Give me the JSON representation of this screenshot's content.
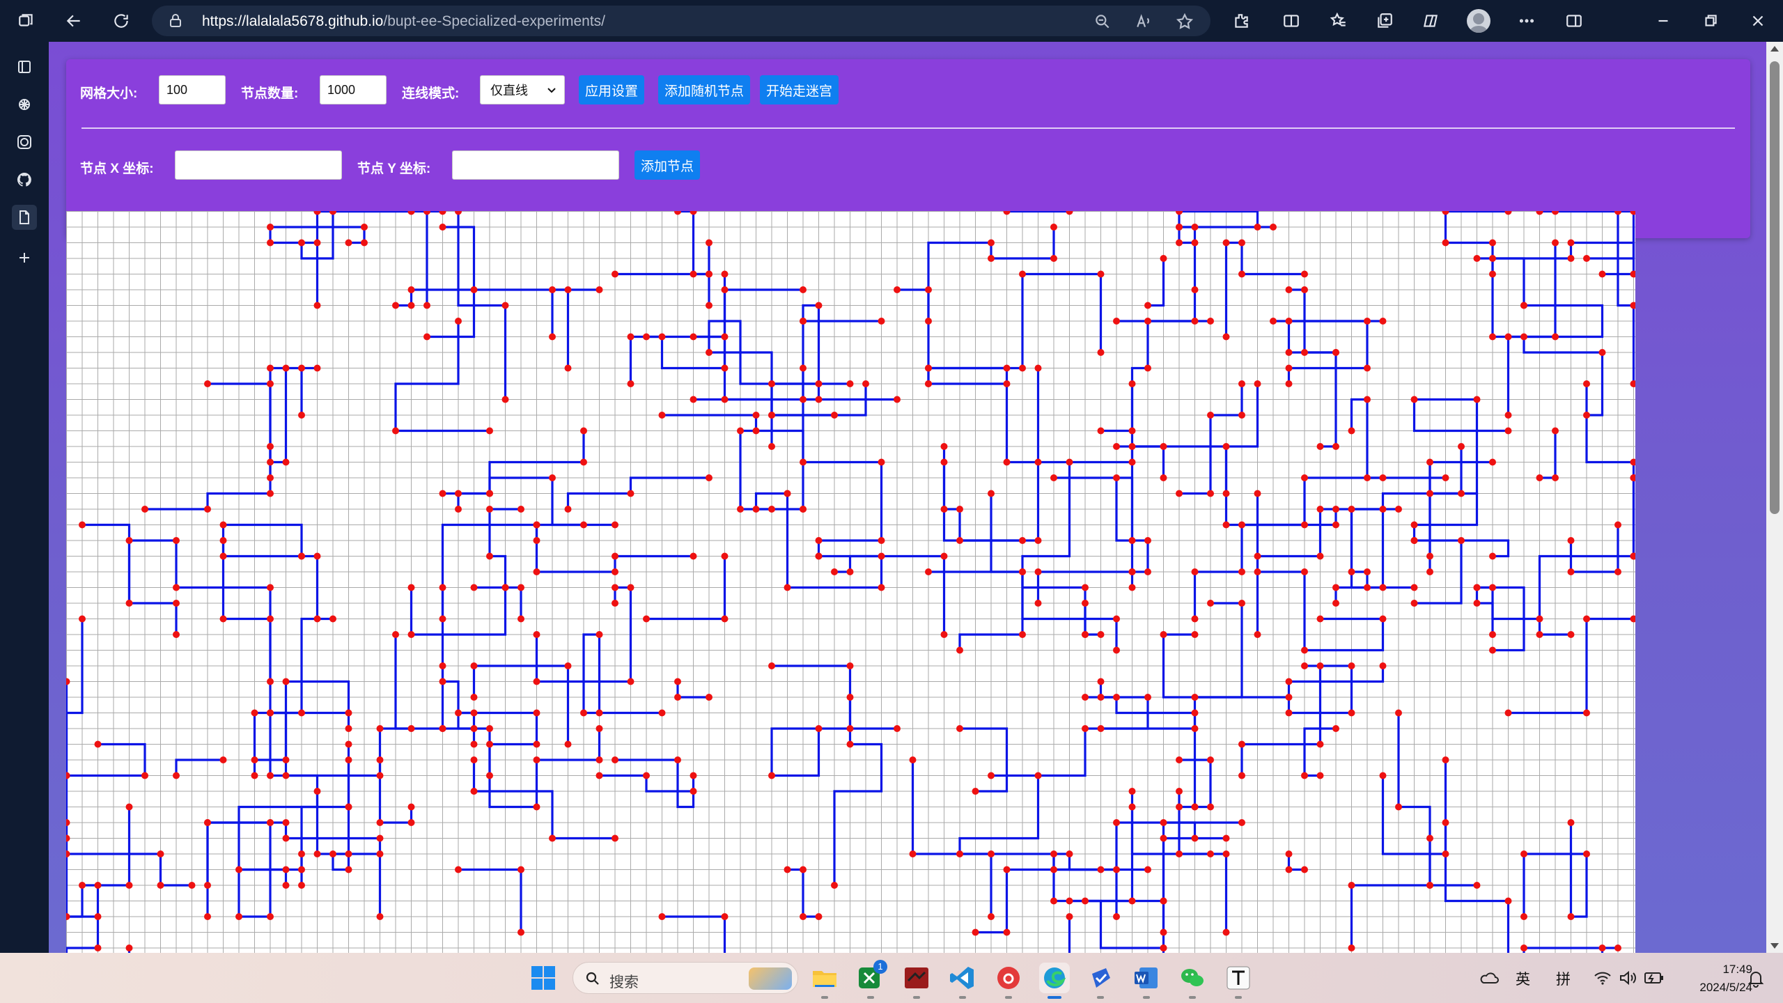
{
  "browser": {
    "url_host": "https://lalalala5678.github.io",
    "url_path": "/bupt-ee-Specialized-experiments/",
    "icons": [
      "workspaces-icon",
      "back-icon",
      "refresh-icon",
      "lock-icon",
      "zoom-icon",
      "read-aloud-icon",
      "favorite-star-icon",
      "extensions-icon",
      "split-screen-icon",
      "favorites-icon",
      "collections-icon",
      "copilot-icon",
      "profile-avatar",
      "more-icon",
      "sidebar-toggle-icon",
      "minimize-icon",
      "restore-icon",
      "close-icon"
    ]
  },
  "sidebar": {
    "items": [
      "tabs-icon",
      "chatgpt-icon",
      "openai-icon",
      "github-icon",
      "document-icon",
      "add-icon"
    ]
  },
  "controls": {
    "grid_size_label": "网格大小:",
    "grid_size_value": "100",
    "node_count_label": "节点数量:",
    "node_count_value": "1000",
    "connect_mode_label": "连线模式:",
    "connect_mode_value": "仅直线",
    "apply_button": "应用设置",
    "add_random_button": "添加随机节点",
    "start_maze_button": "开始走迷宫",
    "node_x_label": "节点 X 坐标:",
    "node_x_value": "",
    "node_y_label": "节点 Y 坐标:",
    "node_y_value": "",
    "add_node_button": "添加节点"
  },
  "maze": {
    "grid_size": 100,
    "visible_columns": 100,
    "visible_rows": 47,
    "line_color": "#0a14e6",
    "node_color": "#ee1111",
    "grid_color": "#aaaaaa"
  },
  "taskbar": {
    "search_placeholder": "搜索",
    "apps": [
      "windows-start-icon",
      "file-explorer-icon",
      "xbox-icon",
      "app-red-icon",
      "vscode-icon",
      "netease-music-icon",
      "edge-icon",
      "app-blue-icon",
      "word-icon",
      "wechat-icon",
      "typora-icon"
    ],
    "xbox_badge": "1",
    "ime_lang": "英",
    "ime_mode": "拼",
    "time": "17:49",
    "date": "2024/5/24"
  },
  "colors": {
    "accent_purple": "#8a3fdc",
    "button_blue": "#0f7ff0",
    "browser_dark": "#0f1b31"
  }
}
